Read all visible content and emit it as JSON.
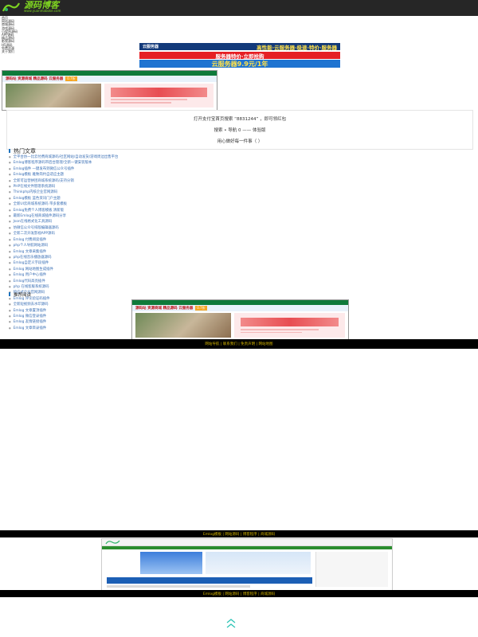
{
  "header": {
    "logo_title": "源码博客",
    "logo_sub": "www.yuanmaboke.com"
  },
  "nav_links": [
    "首页",
    "网站源码",
    "商城源码",
    "游戏源码",
    "小程序源码",
    "APP源码",
    "精品源码",
    "影视源码",
    "H5源码",
    "免费资源",
    "关于我们"
  ],
  "banners": {
    "b1_text": "高性能·云服务器·极速·特价·服务器",
    "b1_badge": "云服务器",
    "b2_text": "服务器特价·立即抢购",
    "b3_text": "云服务器9.9元/1年"
  },
  "ad": {
    "strip_text": "源码站 资源商城 精品源码 云服务器",
    "pill_text": "0.7折"
  },
  "code_box": {
    "line1": "打开支付宝首页搜索 “8831244” ，即可领红包",
    "line2": "搜索 • 导航 0 —— 体验版",
    "line3": "用心做好每一件事（ ）"
  },
  "hot_articles": {
    "heading": "热门文章",
    "items": [
      "全平台仿一比云付费商城源码/社区网站/自动发货/游戏周边出售平台",
      "Emlog博客程序源码带后台管理/全新一键安装版本",
      "Emlog插件 一键发布到微信公众号插件",
      "Emlog模板 雅致简约自适应主题",
      "全新可运营拼团商城系统源码/支持分销",
      "PHP在线文件管理系统源码",
      "Thinkphp内核企业官网源码",
      "Emlog模板 蓝色资讯门户主题",
      "全新UI云商城系统源码 带多套模板",
      "Emlog免费个人博客模板 清新版",
      "最新Emlog在线商城插件源码分享",
      "Json在线格式化工具源码",
      "仿微信公众号排版编辑器源码",
      "全新二次开发影视APP源码",
      "Emlog 付费阅读插件",
      "php个人导航网站源码",
      "Emlog 文章采集插件",
      "php在线音乐播放器源码",
      "Emlog自定义字段插件",
      "Emlog 网站地图生成插件",
      "Emlog 用户中心插件",
      "Emlog代码高亮插件",
      "php 在线客服系统源码",
      "响应式企业官网源码",
      "Emlog 评论验证码插件",
      "全新短视频去水印源码",
      "Emlog 文章置顶插件",
      "Emlog 微信登录插件",
      "Emlog 友情链接插件",
      "Emlog 文章目录插件"
    ]
  },
  "recommended": {
    "heading": "推荐阅读"
  },
  "bands": {
    "band1_text": "网站导航 | 联系我们 | 免责声明 | 网站地图",
    "band2_text": "Emlog模板 | 网站源码 | 博客程序 | 商城源码",
    "band3_text": "Emlog模板 | 网站源码 | 博客程序 | 商城源码"
  },
  "colors": {
    "topbar": "#262626",
    "accent_green": "#7ed321",
    "band_black": "#000000",
    "band_text": "#d4b400",
    "link_blue": "#3a6fb5"
  }
}
